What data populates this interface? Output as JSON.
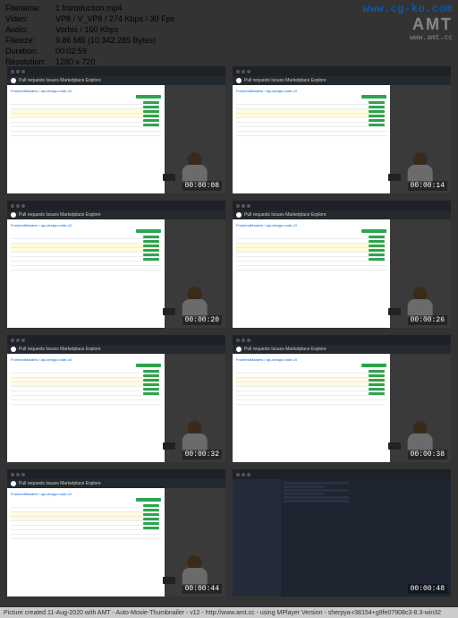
{
  "info": {
    "filename_label": "Filename:",
    "filename_value": "1 Introduction.mp4",
    "video_label": "Video:",
    "video_value": "VP8 / V_VP8 / 274 Kbps / 30 Fps",
    "audio_label": "Audio:",
    "audio_value": "Vorbis / 160 Kbps",
    "filesize_label": "Filesize:",
    "filesize_value": "9.86 MB (10.342.285 Bytes)",
    "duration_label": "Duration:",
    "duration_value": "00:02:59",
    "resolution_label": "Resolution:",
    "resolution_value": "1280 x 720"
  },
  "watermark": {
    "url": "www.cg-ku.com",
    "logo": "AMT",
    "sub": "www.amt.cc"
  },
  "thumbs": [
    {
      "ts": "00:00:08",
      "type": "gh"
    },
    {
      "ts": "00:00:14",
      "type": "gh"
    },
    {
      "ts": "00:00:20",
      "type": "gh"
    },
    {
      "ts": "00:00:26",
      "type": "gh"
    },
    {
      "ts": "00:00:32",
      "type": "gh"
    },
    {
      "ts": "00:00:38",
      "type": "gh"
    },
    {
      "ts": "00:00:44",
      "type": "gh"
    },
    {
      "ts": "00:00:48",
      "type": "editor"
    }
  ],
  "nav": {
    "items": "Pull requests   Issues   Marketplace   Explore"
  },
  "repo": {
    "title": "FrontendMasters / api-design-node-v3"
  },
  "footer": {
    "text": "Picture created 11-Aug-2020 with AMT - Auto-Movie-Thumbnailer - v12 - http://www.amt.cc - using MPlayer Version - sherpya-r38154+g9fe07908c3-8.3-win32"
  }
}
